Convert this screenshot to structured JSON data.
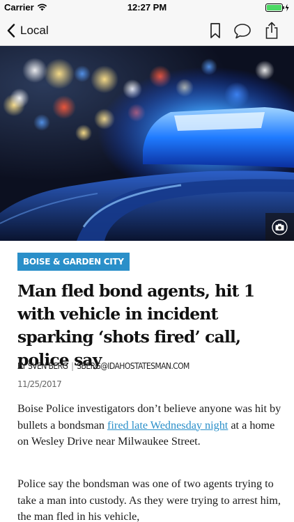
{
  "status_bar": {
    "carrier": "Carrier",
    "time": "12:27 PM",
    "battery_color": "#4cd964"
  },
  "nav": {
    "back_label": "Local",
    "icons": [
      "chevron-left-icon",
      "bookmark-icon",
      "comment-icon",
      "share-icon"
    ]
  },
  "hero": {
    "description_icon": "camera-icon"
  },
  "article": {
    "section": "BOISE & GARDEN CITY",
    "section_color": "#2a8fc9",
    "headline": "Man fled bond agents, hit 1 with vehicle in incident sparking ‘shots fired’ call, police say",
    "author": "BY SVEN BERG",
    "email": "SBERG@IDAHOSTATESMAN.COM",
    "date": "11/25/2017",
    "p1_before": "Boise Police investigators don’t believe anyone was hit by bullets a bondsman ",
    "p1_link": "fired late Wednesday night",
    "p1_after": " at a home on Wesley Drive near Milwaukee Street.",
    "p2": "Police say the bondsman was one of two agents trying to take a man into custody. As they were trying to arrest him, the man fled in his vehicle,"
  }
}
